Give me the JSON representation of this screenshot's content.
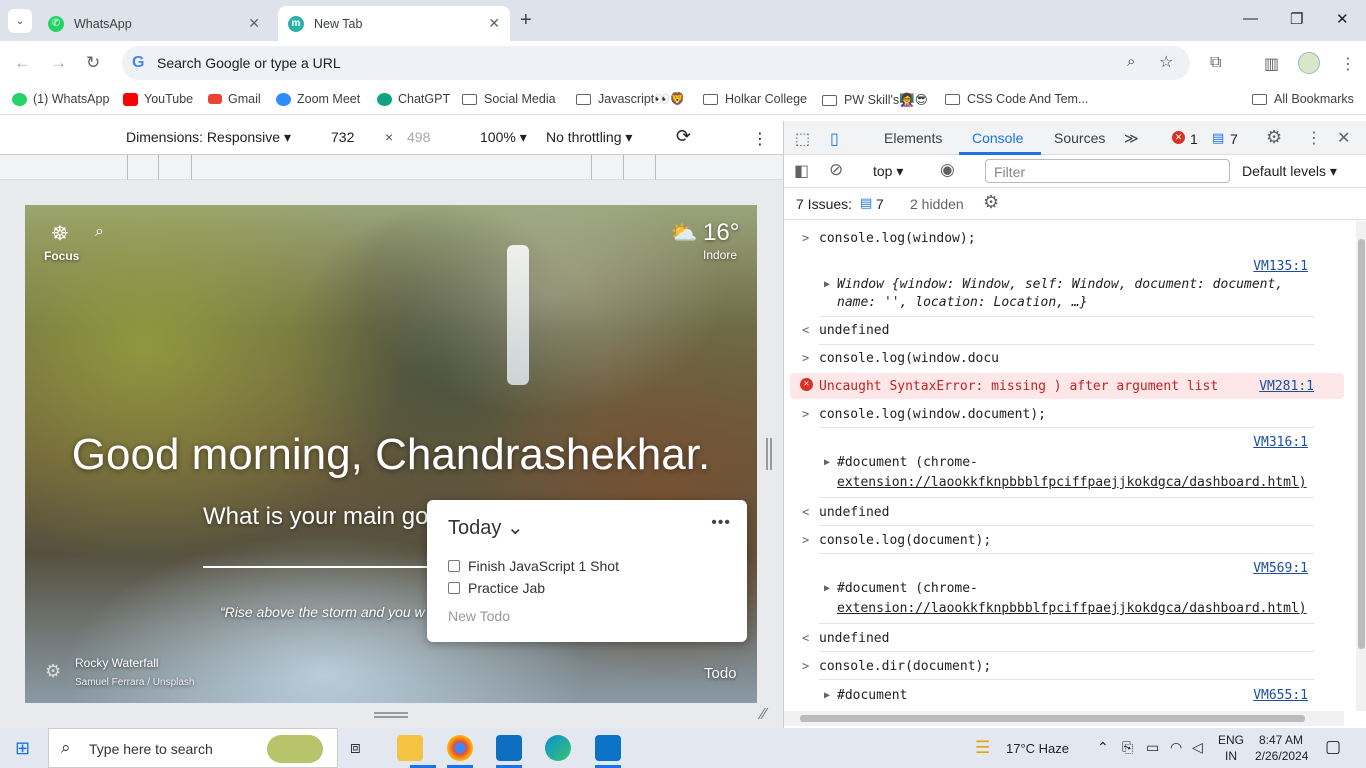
{
  "tabs": [
    {
      "title": "WhatsApp",
      "favicon": "whatsapp-icon"
    },
    {
      "title": "New Tab",
      "favicon": "momentum-icon"
    }
  ],
  "omnibox": {
    "placeholder": "Search Google or type a URL"
  },
  "bookmarks": [
    "(1) WhatsApp",
    "YouTube",
    "Gmail",
    "Zoom Meet",
    "ChatGPT",
    "Social Media",
    "Javascript👀🦁",
    "Holkar College",
    "PW Skill's👩‍🏫😎",
    "CSS Code And Tem..."
  ],
  "all_bookmarks": "All Bookmarks",
  "device_toolbar": {
    "dimensions": "Dimensions: Responsive ▾",
    "width": "732",
    "times": "×",
    "height": "498",
    "zoom": "100% ▾",
    "throttle": "No throttling ▾"
  },
  "newtab": {
    "focus_label": "Focus",
    "temperature": "16°",
    "city": "Indore",
    "greeting": "Good morning, Chandrashekhar.",
    "focus_question": "What is your main goal for today?",
    "quote": "“Rise above the storm and you w",
    "photo_title": "Rocky Waterfall",
    "photo_credit": "Samuel Ferrara / Unsplash",
    "todo_label": "Todo",
    "todo_panel": {
      "heading": "Today ⌄",
      "items": [
        "Finish JavaScript 1 Shot",
        "Practice Jab"
      ],
      "new_placeholder": "New Todo"
    }
  },
  "devtools": {
    "tabs": [
      "Elements",
      "Console",
      "Sources",
      "≫"
    ],
    "error_count": "1",
    "message_count": "7",
    "context": "top ▾",
    "filter_placeholder": "Filter",
    "levels": "Default levels ▾",
    "issues": "7 Issues:",
    "issues_count": "7",
    "hidden": "2 hidden",
    "console": [
      {
        "type": "input",
        "text": "console.log(window);"
      },
      {
        "type": "source",
        "src": "VM135:1"
      },
      {
        "type": "output",
        "line1": "Window {window: Window, self: Window, document: document,",
        "line2": "name: '', location: Location, …}"
      },
      {
        "type": "return",
        "text": "undefined"
      },
      {
        "type": "input",
        "text": "console.log(window.docu"
      },
      {
        "type": "error",
        "text": "Uncaught SyntaxError: missing ) after argument list",
        "src": "VM281:1"
      },
      {
        "type": "input",
        "text": "console.log(window.document);"
      },
      {
        "type": "source",
        "src": "VM316:1"
      },
      {
        "type": "output",
        "line1": "#document (chrome-",
        "line2": "extension://laookkfknpbbblfpciffpaejjkokdgca/dashboard.html)"
      },
      {
        "type": "return",
        "text": "undefined"
      },
      {
        "type": "input",
        "text": "console.log(document);"
      },
      {
        "type": "source",
        "src": "VM569:1"
      },
      {
        "type": "output",
        "line1": "#document (chrome-",
        "line2": "extension://laookkfknpbbblfpciffpaejjkokdgca/dashboard.html)"
      },
      {
        "type": "return",
        "text": "undefined"
      },
      {
        "type": "input",
        "text": "console.dir(document);"
      },
      {
        "type": "output",
        "line1": "#document",
        "src": "VM655:1"
      }
    ]
  },
  "taskbar": {
    "search_placeholder": "Type here to search",
    "weather": "17°C  Haze",
    "lang1": "ENG",
    "lang2": "IN",
    "time": "8:47 AM",
    "date": "2/26/2024"
  }
}
